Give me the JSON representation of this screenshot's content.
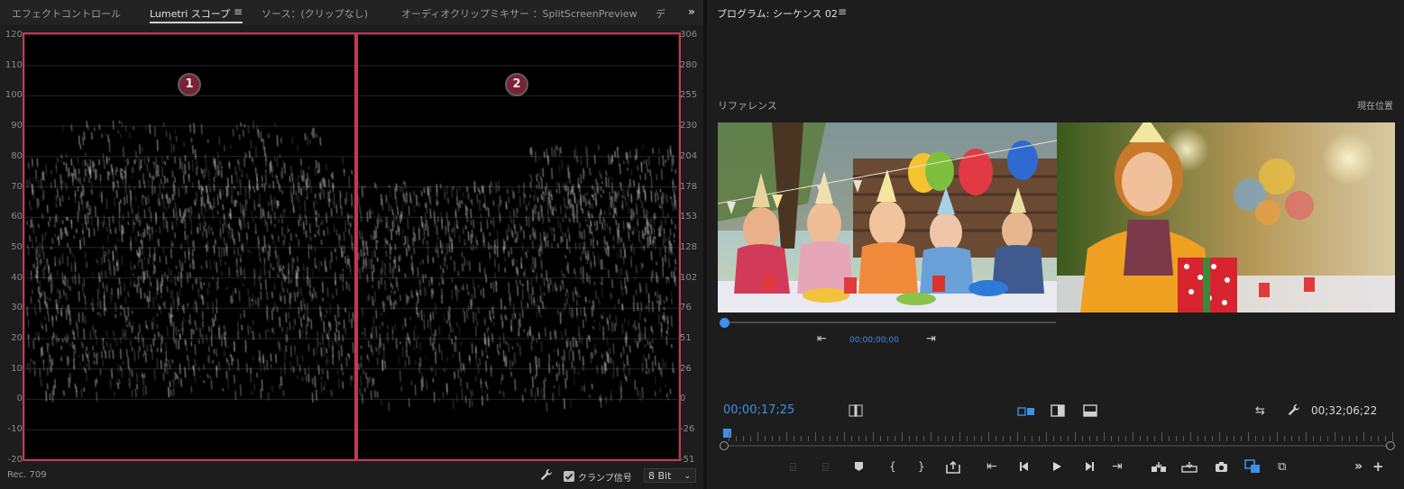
{
  "left_tabs": {
    "effect_controls": "エフェクトコントロール",
    "lumetri_scope": "Lumetri スコープ",
    "source": "ソース：(クリップなし)",
    "audio_mixer": "オーディオクリップミキサー ：SplitScreenPreview",
    "overflow_label": "デ",
    "menu_icon": "hamburger-menu-icon",
    "expand_icon": "double-chevron-right-icon"
  },
  "scope": {
    "left_scale": [
      "120",
      "110",
      "100",
      "90",
      "80",
      "70",
      "60",
      "50",
      "40",
      "30",
      "20",
      "10",
      "0",
      "-10",
      "-20"
    ],
    "right_scale": [
      "306",
      "280",
      "255",
      "230",
      "204",
      "178",
      "153",
      "128",
      "102",
      "76",
      "51",
      "26",
      "0",
      "-26",
      "-51"
    ],
    "markers": [
      "1",
      "2"
    ],
    "marker_color": "#c23a52",
    "background": "#000000"
  },
  "left_footer": {
    "colorspace": "Rec. 709",
    "clamp_label": "クランプ信号",
    "clamp_checked": true,
    "bit_depth": "8 Bit",
    "wrench_icon": "wrench-icon"
  },
  "program": {
    "title": "プログラム: シーケンス 02",
    "reference_label": "リファレンス",
    "current_label": "現在位置",
    "reference_timecode": "00;00;00;00",
    "current_timecode": "00;00;17;25",
    "duration_timecode": "00;32;06;22",
    "accent": "#3f8ee8"
  },
  "transport_icons": [
    "mark-in-icon",
    "mark-out-icon",
    "add-marker-icon",
    "go-to-in-icon",
    "go-to-out-icon",
    "lift-icon",
    "step-back-icon",
    "play-icon",
    "step-forward-icon",
    "go-to-next-edit-icon",
    "insert-icon",
    "overwrite-icon",
    "export-frame-icon",
    "comparison-view-icon",
    "split-view-icon",
    "more-icon",
    "add-button-icon"
  ]
}
